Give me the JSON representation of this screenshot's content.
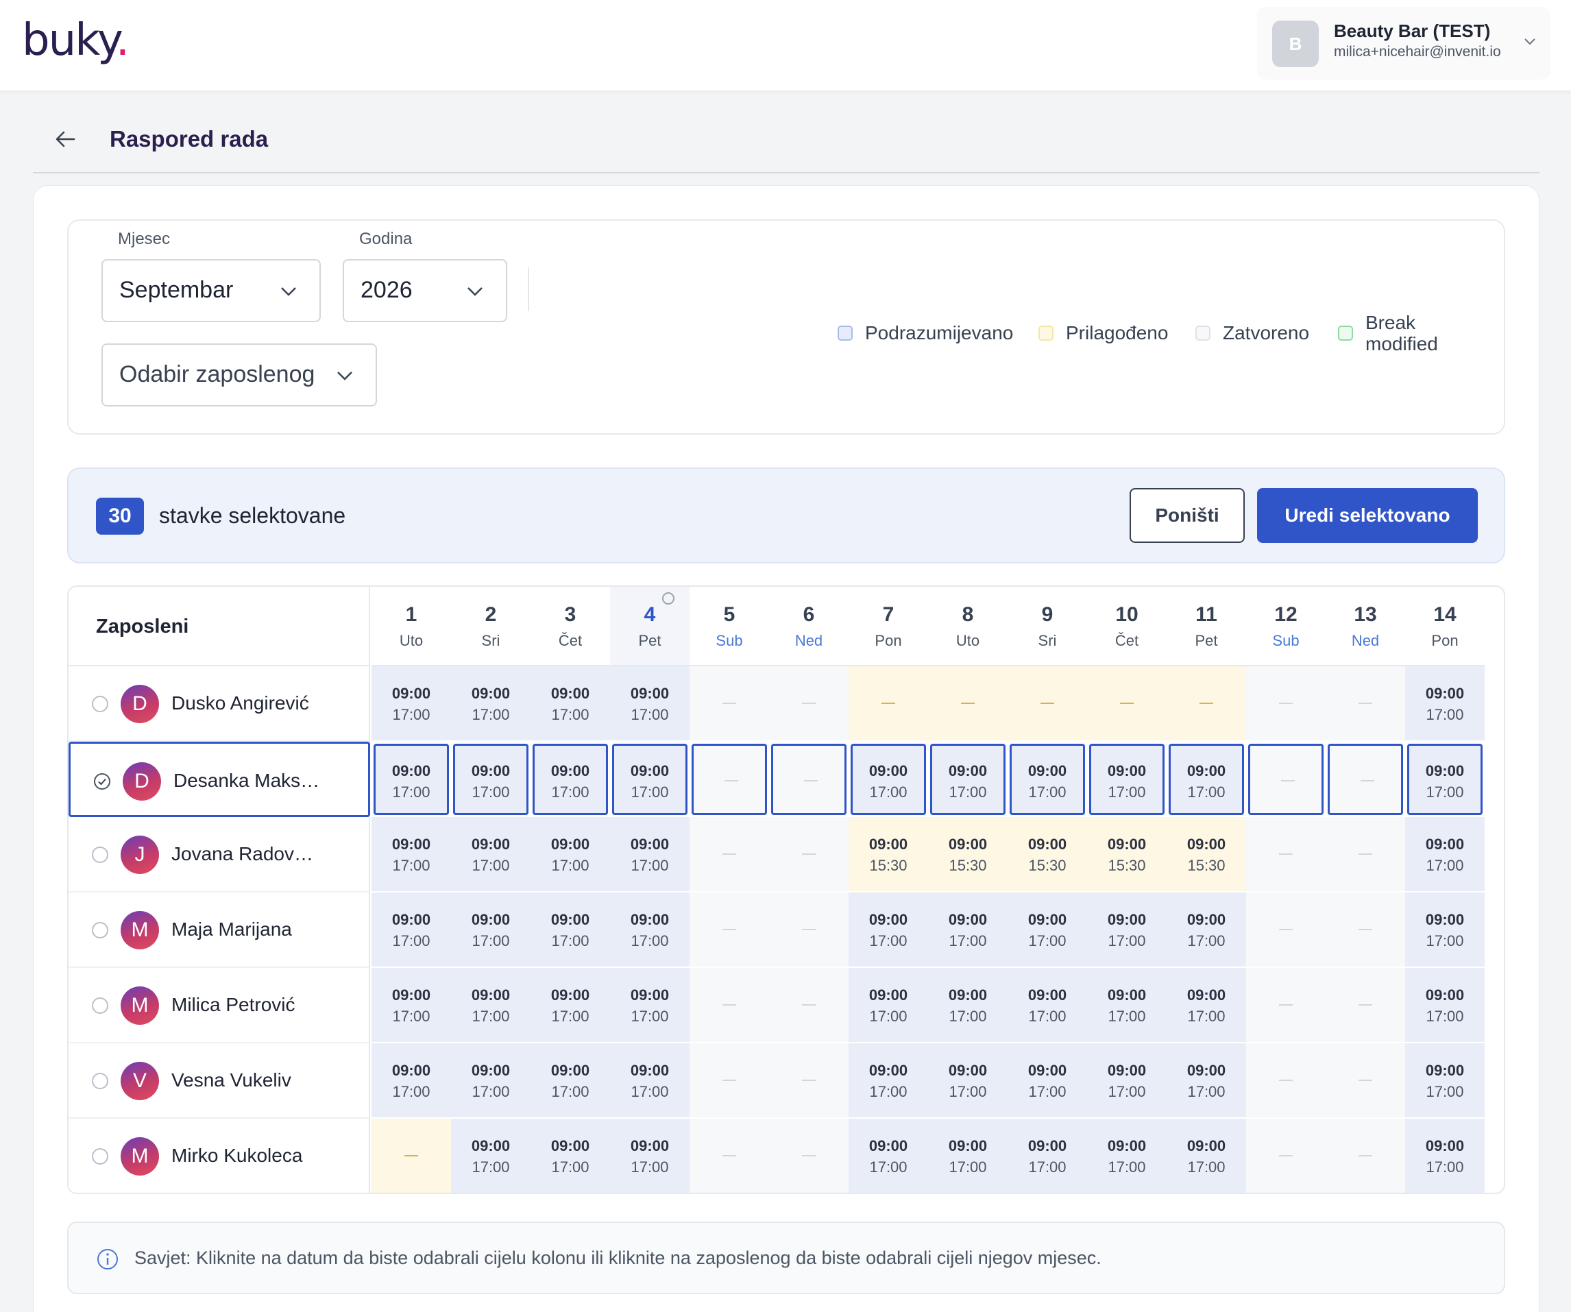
{
  "app": {
    "logo_text": "buky",
    "logo_dot": "."
  },
  "account": {
    "initial": "B",
    "name": "Beauty Bar (TEST)",
    "email": "milica+nicehair@invenit.io"
  },
  "page": {
    "title": "Raspored rada"
  },
  "filters": {
    "month_label": "Mjesec",
    "month_value": "Septembar",
    "year_label": "Godina",
    "year_value": "2026",
    "employee_placeholder": "Odabir zaposlenog"
  },
  "legend": [
    {
      "label": "Podrazumijevano",
      "color": "#a9bde8"
    },
    {
      "label": "Prilagođeno",
      "color": "#f5e6a6"
    },
    {
      "label": "Zatvoreno",
      "color": "#dfe2e6"
    },
    {
      "label": "Break",
      "label2": "modified",
      "color": "#8fdca2"
    }
  ],
  "selection": {
    "count": "30",
    "text": "stavke selektovane",
    "cancel_label": "Poništi",
    "edit_label": "Uredi selektovano"
  },
  "grid": {
    "employees_header": "Zaposleni",
    "days": [
      {
        "num": "1",
        "wd": "Uto"
      },
      {
        "num": "2",
        "wd": "Sri"
      },
      {
        "num": "3",
        "wd": "Čet"
      },
      {
        "num": "4",
        "wd": "Pet"
      },
      {
        "num": "5",
        "wd": "Sub"
      },
      {
        "num": "6",
        "wd": "Ned"
      },
      {
        "num": "7",
        "wd": "Pon"
      },
      {
        "num": "8",
        "wd": "Uto"
      },
      {
        "num": "9",
        "wd": "Sri"
      },
      {
        "num": "10",
        "wd": "Čet"
      },
      {
        "num": "11",
        "wd": "Pet"
      },
      {
        "num": "12",
        "wd": "Sub"
      },
      {
        "num": "13",
        "wd": "Ned"
      },
      {
        "num": "14",
        "wd": "Pon"
      }
    ],
    "employees": [
      {
        "initial": "D",
        "name": "Dusko Angirević",
        "selected": false,
        "cells": [
          [
            "def",
            "09:00",
            "17:00"
          ],
          [
            "def",
            "09:00",
            "17:00"
          ],
          [
            "def",
            "09:00",
            "17:00"
          ],
          [
            "def",
            "09:00",
            "17:00"
          ],
          [
            "clo"
          ],
          [
            "clo"
          ],
          [
            "cus"
          ],
          [
            "cus"
          ],
          [
            "cus"
          ],
          [
            "cus"
          ],
          [
            "cus"
          ],
          [
            "clo"
          ],
          [
            "clo"
          ],
          [
            "def",
            "09:00",
            "17:00"
          ]
        ]
      },
      {
        "initial": "D",
        "name": "Desanka Maks…",
        "selected": true,
        "cells": [
          [
            "def",
            "09:00",
            "17:00"
          ],
          [
            "def",
            "09:00",
            "17:00"
          ],
          [
            "def",
            "09:00",
            "17:00"
          ],
          [
            "def",
            "09:00",
            "17:00"
          ],
          [
            "clo"
          ],
          [
            "clo"
          ],
          [
            "def",
            "09:00",
            "17:00"
          ],
          [
            "def",
            "09:00",
            "17:00"
          ],
          [
            "def",
            "09:00",
            "17:00"
          ],
          [
            "def",
            "09:00",
            "17:00"
          ],
          [
            "def",
            "09:00",
            "17:00"
          ],
          [
            "clo"
          ],
          [
            "clo"
          ],
          [
            "def",
            "09:00",
            "17:00"
          ]
        ]
      },
      {
        "initial": "J",
        "name": "Jovana Radov…",
        "selected": false,
        "cells": [
          [
            "def",
            "09:00",
            "17:00"
          ],
          [
            "def",
            "09:00",
            "17:00"
          ],
          [
            "def",
            "09:00",
            "17:00"
          ],
          [
            "def",
            "09:00",
            "17:00"
          ],
          [
            "clo"
          ],
          [
            "clo"
          ],
          [
            "cus",
            "09:00",
            "15:30"
          ],
          [
            "cus",
            "09:00",
            "15:30"
          ],
          [
            "cus",
            "09:00",
            "15:30"
          ],
          [
            "cus",
            "09:00",
            "15:30"
          ],
          [
            "cus",
            "09:00",
            "15:30"
          ],
          [
            "clo"
          ],
          [
            "clo"
          ],
          [
            "def",
            "09:00",
            "17:00"
          ]
        ]
      },
      {
        "initial": "M",
        "name": "Maja Marijana",
        "selected": false,
        "cells": [
          [
            "def",
            "09:00",
            "17:00"
          ],
          [
            "def",
            "09:00",
            "17:00"
          ],
          [
            "def",
            "09:00",
            "17:00"
          ],
          [
            "def",
            "09:00",
            "17:00"
          ],
          [
            "clo"
          ],
          [
            "clo"
          ],
          [
            "def",
            "09:00",
            "17:00"
          ],
          [
            "def",
            "09:00",
            "17:00"
          ],
          [
            "def",
            "09:00",
            "17:00"
          ],
          [
            "def",
            "09:00",
            "17:00"
          ],
          [
            "def",
            "09:00",
            "17:00"
          ],
          [
            "clo"
          ],
          [
            "clo"
          ],
          [
            "def",
            "09:00",
            "17:00"
          ]
        ]
      },
      {
        "initial": "M",
        "name": "Milica Petrović",
        "selected": false,
        "cells": [
          [
            "def",
            "09:00",
            "17:00"
          ],
          [
            "def",
            "09:00",
            "17:00"
          ],
          [
            "def",
            "09:00",
            "17:00"
          ],
          [
            "def",
            "09:00",
            "17:00"
          ],
          [
            "clo"
          ],
          [
            "clo"
          ],
          [
            "def",
            "09:00",
            "17:00"
          ],
          [
            "def",
            "09:00",
            "17:00"
          ],
          [
            "def",
            "09:00",
            "17:00"
          ],
          [
            "def",
            "09:00",
            "17:00"
          ],
          [
            "def",
            "09:00",
            "17:00"
          ],
          [
            "clo"
          ],
          [
            "clo"
          ],
          [
            "def",
            "09:00",
            "17:00"
          ]
        ]
      },
      {
        "initial": "V",
        "name": "Vesna Vukeliv",
        "selected": false,
        "cells": [
          [
            "def",
            "09:00",
            "17:00"
          ],
          [
            "def",
            "09:00",
            "17:00"
          ],
          [
            "def",
            "09:00",
            "17:00"
          ],
          [
            "def",
            "09:00",
            "17:00"
          ],
          [
            "clo"
          ],
          [
            "clo"
          ],
          [
            "def",
            "09:00",
            "17:00"
          ],
          [
            "def",
            "09:00",
            "17:00"
          ],
          [
            "def",
            "09:00",
            "17:00"
          ],
          [
            "def",
            "09:00",
            "17:00"
          ],
          [
            "def",
            "09:00",
            "17:00"
          ],
          [
            "clo"
          ],
          [
            "clo"
          ],
          [
            "def",
            "09:00",
            "17:00"
          ]
        ]
      },
      {
        "initial": "M",
        "name": "Mirko Kukoleca",
        "selected": false,
        "cells": [
          [
            "cus"
          ],
          [
            "def",
            "09:00",
            "17:00"
          ],
          [
            "def",
            "09:00",
            "17:00"
          ],
          [
            "def",
            "09:00",
            "17:00"
          ],
          [
            "clo"
          ],
          [
            "clo"
          ],
          [
            "def",
            "09:00",
            "17:00"
          ],
          [
            "def",
            "09:00",
            "17:00"
          ],
          [
            "def",
            "09:00",
            "17:00"
          ],
          [
            "def",
            "09:00",
            "17:00"
          ],
          [
            "def",
            "09:00",
            "17:00"
          ],
          [
            "clo"
          ],
          [
            "clo"
          ],
          [
            "def",
            "09:00",
            "17:00"
          ]
        ]
      }
    ]
  },
  "tip": {
    "text": "Savjet: Kliknite na datum da biste odabrali cijelu kolonu ili kliknite na zaposlenog da biste odabrali cijeli njegov mjesec."
  }
}
